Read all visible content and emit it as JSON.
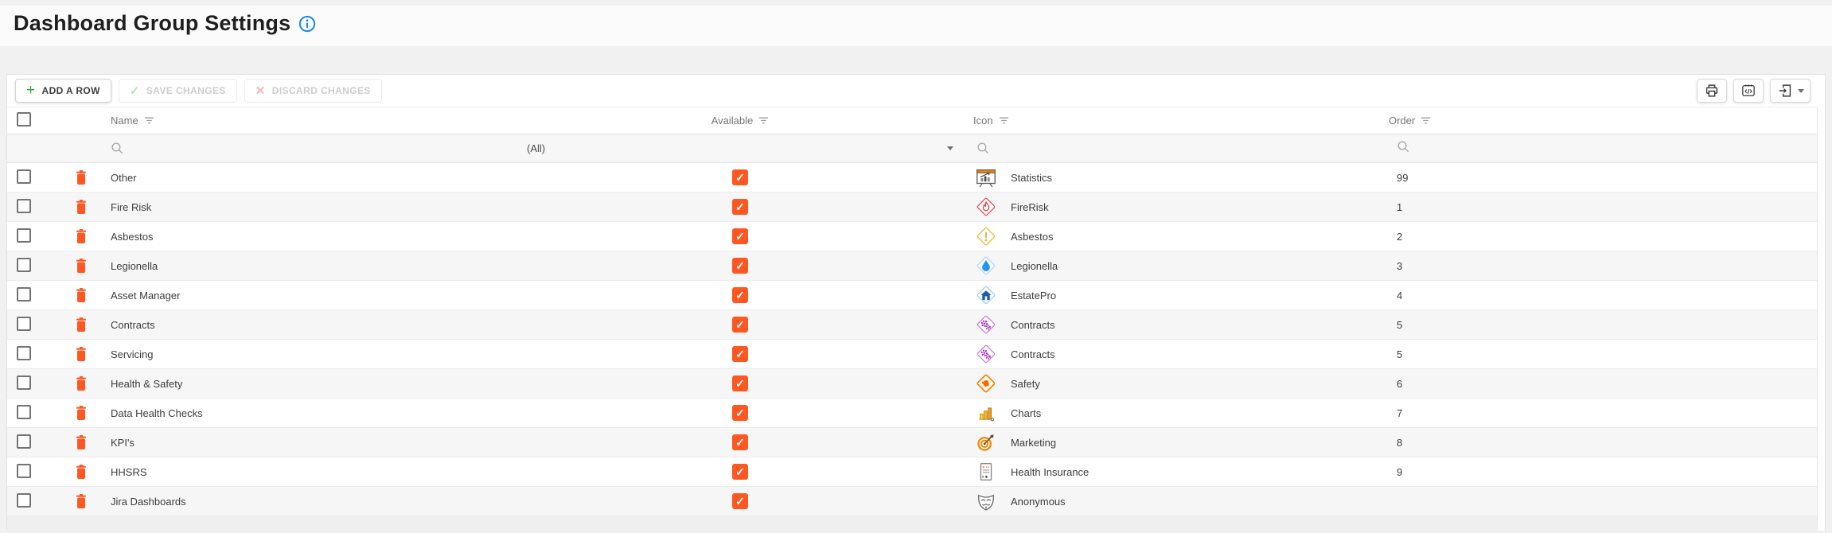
{
  "page": {
    "title": "Dashboard Group Settings",
    "info_icon": "info-icon"
  },
  "toolbar": {
    "add_row_label": "ADD A ROW",
    "save_changes_label": "SAVE CHANGES",
    "discard_changes_label": "DISCARD CHANGES",
    "icon_buttons": [
      "print-icon",
      "code-export-icon",
      "export-file-icon"
    ]
  },
  "grid": {
    "columns": {
      "name": "Name",
      "available": "Available",
      "icon": "Icon",
      "order": "Order"
    },
    "filter_row": {
      "available_filter_value": "(All)"
    },
    "rows": [
      {
        "name": "Other",
        "available": true,
        "icon": "statistics",
        "icon_label": "Statistics",
        "order": "99"
      },
      {
        "name": "Fire Risk",
        "available": true,
        "icon": "firerisk",
        "icon_label": "FireRisk",
        "order": "1"
      },
      {
        "name": "Asbestos",
        "available": true,
        "icon": "asbestos",
        "icon_label": "Asbestos",
        "order": "2"
      },
      {
        "name": "Legionella",
        "available": true,
        "icon": "legionella",
        "icon_label": "Legionella",
        "order": "3"
      },
      {
        "name": "Asset Manager",
        "available": true,
        "icon": "estatepro",
        "icon_label": "EstatePro",
        "order": "4"
      },
      {
        "name": "Contracts",
        "available": true,
        "icon": "contracts",
        "icon_label": "Contracts",
        "order": "5"
      },
      {
        "name": "Servicing",
        "available": true,
        "icon": "contracts",
        "icon_label": "Contracts",
        "order": "5"
      },
      {
        "name": "Health & Safety",
        "available": true,
        "icon": "safety",
        "icon_label": "Safety",
        "order": "6"
      },
      {
        "name": "Data Health Checks",
        "available": true,
        "icon": "charts",
        "icon_label": "Charts",
        "order": "7"
      },
      {
        "name": "KPI's",
        "available": true,
        "icon": "marketing",
        "icon_label": "Marketing",
        "order": "8"
      },
      {
        "name": "HHSRS",
        "available": true,
        "icon": "healthinsurance",
        "icon_label": "Health Insurance",
        "order": "9"
      },
      {
        "name": "Jira Dashboards",
        "available": true,
        "icon": "anonymous",
        "icon_label": "Anonymous",
        "order": ""
      }
    ]
  },
  "colors": {
    "accent_orange": "#ff5722",
    "add_green": "#43a047",
    "info_blue": "#1e88e5",
    "disabled_green": "#bcdfbd",
    "disabled_red": "#f1b8b4"
  }
}
